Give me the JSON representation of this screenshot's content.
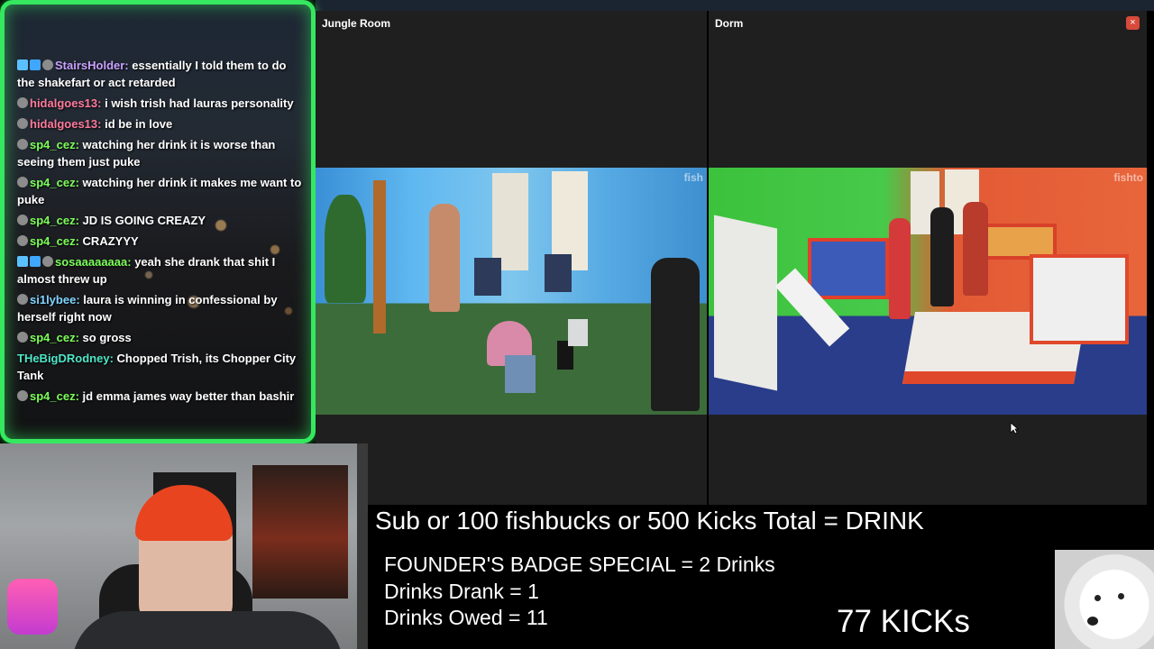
{
  "chat": {
    "messages": [
      {
        "badges": [
          "b1",
          "b2",
          "b3"
        ],
        "user": "StairsHolder",
        "color": "#c9a0ff",
        "text": "essentially I told them to do the shakefart or act retarded"
      },
      {
        "badges": [
          "b3"
        ],
        "user": "hidalgoes13",
        "color": "#ff7a9c",
        "text": "i wish trish had lauras personality"
      },
      {
        "badges": [
          "b3"
        ],
        "user": "hidalgoes13",
        "color": "#ff7a9c",
        "text": "id be in love"
      },
      {
        "badges": [
          "b3"
        ],
        "user": "sp4_cez",
        "color": "#7dff5a",
        "text": "watching her drink it is worse than seeing them just puke"
      },
      {
        "badges": [
          "b3"
        ],
        "user": "sp4_cez",
        "color": "#7dff5a",
        "text": "watching her drink it makes me want to puke"
      },
      {
        "badges": [
          "b3"
        ],
        "user": "sp4_cez",
        "color": "#7dff5a",
        "text": "JD IS GOING CREAZY"
      },
      {
        "badges": [
          "b3"
        ],
        "user": "sp4_cez",
        "color": "#7dff5a",
        "text": "CRAZYYY"
      },
      {
        "badges": [
          "b1",
          "b2",
          "b3"
        ],
        "user": "sosaaaaaaaa",
        "color": "#7dff5a",
        "text": "yeah she drank that shit I almost threw up"
      },
      {
        "badges": [
          "b3"
        ],
        "user": "si1lybee",
        "color": "#7fd4ff",
        "text": "laura is winning in confessional by herself right now"
      },
      {
        "badges": [
          "b3"
        ],
        "user": "sp4_cez",
        "color": "#7dff5a",
        "text": "so gross"
      },
      {
        "badges": [],
        "user": "THeBigDRodney",
        "color": "#4ee6c6",
        "text": "Chopped Trish, its Chopper City Tank"
      },
      {
        "badges": [
          "b3"
        ],
        "user": "sp4_cez",
        "color": "#7dff5a",
        "text": "jd emma james way better than bashir"
      }
    ]
  },
  "panels": {
    "jungle": {
      "title": "Jungle Room",
      "watermark": "fish"
    },
    "dorm": {
      "title": "Dorm",
      "watermark": "fishto",
      "close": "×"
    }
  },
  "stats": {
    "headline": "Sub or 100 fishbucks or 500 Kicks Total = DRINK",
    "founder": "FOUNDER'S BADGE SPECIAL = 2 Drinks",
    "drank": "Drinks Drank = 1",
    "owed": "Drinks Owed = 11",
    "kicks": "77 KICKs"
  },
  "colors": {
    "chat_border": "#35e85f",
    "close_button": "#d84a3a"
  }
}
